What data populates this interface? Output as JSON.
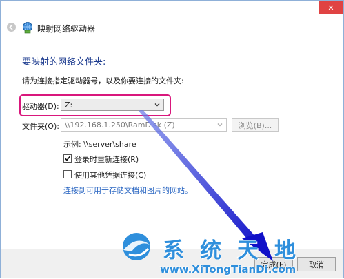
{
  "window": {
    "title": "映射网络驱动器",
    "close_glyph": "✕"
  },
  "main": {
    "heading": "要映射的网络文件夹:",
    "instruction": "请为连接指定驱动器号，以及你要连接的文件夹:"
  },
  "form": {
    "drive_label": "驱动器(D):",
    "drive_value": "Z:",
    "folder_label": "文件夹(O):",
    "folder_value": "\\\\192.168.1.250\\RamDisk (Z)",
    "browse_label": "浏览(B)...",
    "example": "示例: \\\\server\\share",
    "reconnect_label": "登录时重新连接(R)",
    "reconnect_checked": true,
    "other_creds_label": "使用其他凭据连接(C)",
    "other_creds_checked": false,
    "link_text": "连接到可用于存储文档和图片的网站。"
  },
  "footer": {
    "finish_label": "完成(F)",
    "cancel_label": "取消"
  },
  "watermark": {
    "chinese": "系统天地",
    "url": "www.XiTongTianDi.com"
  },
  "colors": {
    "accent": "#1c3b8f",
    "highlight_border": "#d9177c",
    "arrow": "#2a2ad0",
    "close_button": "#e04343",
    "link": "#2a66c2"
  },
  "icons": {
    "back": "back-arrow-icon",
    "wizard": "network-drive-icon",
    "close": "close-icon",
    "dropdown": "chevron-down-icon",
    "check": "checkmark-icon"
  }
}
